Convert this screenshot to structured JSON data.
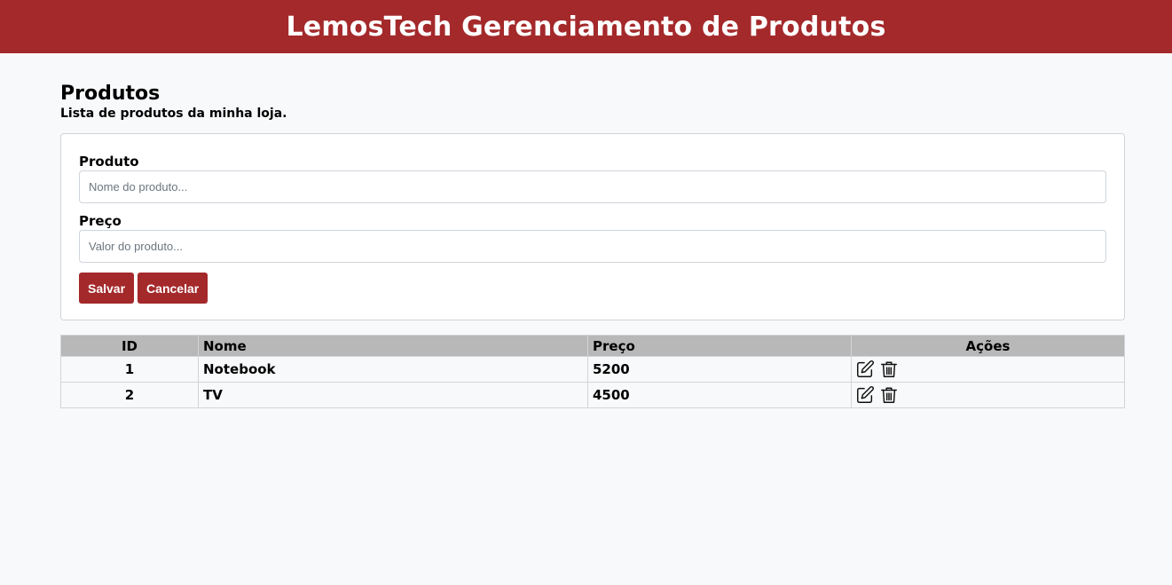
{
  "header": {
    "title": "LemosTech Gerenciamento de Produtos"
  },
  "page": {
    "title": "Produtos",
    "subtitle": "Lista de produtos da minha loja."
  },
  "form": {
    "product_label": "Produto",
    "product_placeholder": "Nome do produto...",
    "product_value": "",
    "price_label": "Preço",
    "price_placeholder": "Valor do produto...",
    "price_value": "",
    "save_label": "Salvar",
    "cancel_label": "Cancelar"
  },
  "table": {
    "headers": {
      "id": "ID",
      "nome": "Nome",
      "preco": "Preço",
      "acoes": "Ações"
    },
    "rows": [
      {
        "id": "1",
        "nome": "Notebook",
        "preco": "5200",
        "actions": [
          "edit-icon",
          "trash-icon"
        ]
      },
      {
        "id": "2",
        "nome": "TV",
        "preco": "4500",
        "actions": [
          "edit-icon",
          "trash-icon"
        ]
      }
    ]
  },
  "colors": {
    "brand": "#a4292b",
    "table_header": "#b8b8b8",
    "background": "#f8f9fa"
  }
}
